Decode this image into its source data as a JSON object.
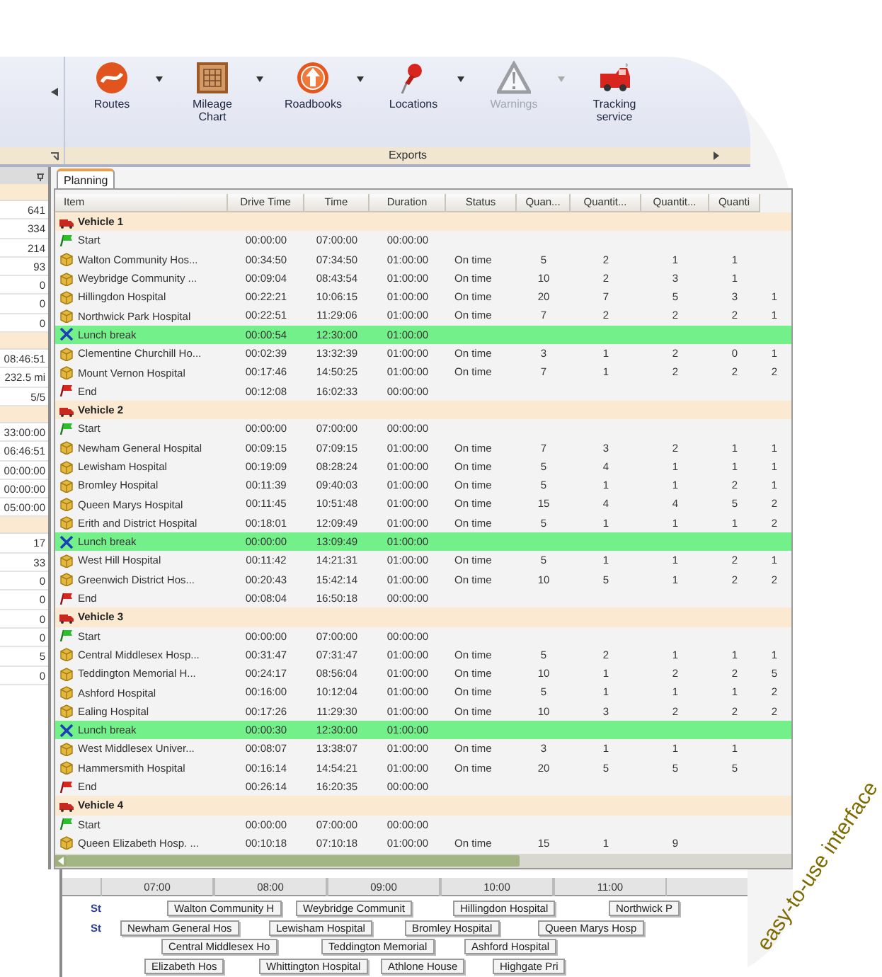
{
  "ribbon": {
    "buttons": [
      {
        "label": "Routes",
        "disabled": false,
        "dropdown": true
      },
      {
        "label": "Mileage Chart",
        "disabled": false,
        "dropdown": true
      },
      {
        "label": "Roadbooks",
        "disabled": false,
        "dropdown": true
      },
      {
        "label": "Locations",
        "disabled": false,
        "dropdown": true
      },
      {
        "label": "Warnings",
        "disabled": true,
        "dropdown": true
      },
      {
        "label": "Tracking service",
        "disabled": false,
        "dropdown": false
      }
    ],
    "group_label": "Exports"
  },
  "left_panel": {
    "sections": [
      {
        "values": [
          "641",
          "334",
          "214",
          "93",
          "0",
          "0",
          "0"
        ]
      },
      {
        "values": [
          "08:46:51",
          "232.5 mi",
          "5/5"
        ]
      },
      {
        "values": [
          "33:00:00",
          "06:46:51",
          "00:00:00",
          "00:00:00",
          "05:00:00"
        ]
      },
      {
        "values": [
          "17",
          "33",
          "0",
          "0",
          "0",
          "0",
          "5",
          "0"
        ]
      }
    ]
  },
  "tabs": [
    {
      "label": "Planning",
      "selected": true
    }
  ],
  "table": {
    "columns": [
      "Item",
      "Drive Time",
      "Time",
      "Duration",
      "Status",
      "Quan...",
      "Quantit...",
      "Quantit...",
      "Quanti"
    ],
    "rows": [
      {
        "kind": "vehicle",
        "cells": [
          "Vehicle 1"
        ]
      },
      {
        "kind": "start",
        "cells": [
          "Start",
          "00:00:00",
          "07:00:00",
          "00:00:00"
        ]
      },
      {
        "kind": "stop",
        "cells": [
          "Walton Community Hos...",
          "00:34:50",
          "07:34:50",
          "01:00:00",
          "On time",
          "5",
          "2",
          "1",
          "1"
        ]
      },
      {
        "kind": "stop",
        "cells": [
          "Weybridge Community ...",
          "00:09:04",
          "08:43:54",
          "01:00:00",
          "On time",
          "10",
          "2",
          "3",
          "1"
        ]
      },
      {
        "kind": "stop",
        "cells": [
          "Hillingdon Hospital",
          "00:22:21",
          "10:06:15",
          "01:00:00",
          "On time",
          "20",
          "7",
          "5",
          "3",
          "1"
        ]
      },
      {
        "kind": "stop",
        "cells": [
          "Northwick Park Hospital",
          "00:22:51",
          "11:29:06",
          "01:00:00",
          "On time",
          "7",
          "2",
          "2",
          "2",
          "1"
        ]
      },
      {
        "kind": "break",
        "cells": [
          "Lunch break",
          "00:00:54",
          "12:30:00",
          "01:00:00"
        ]
      },
      {
        "kind": "stop",
        "cells": [
          "Clementine Churchill Ho...",
          "00:02:39",
          "13:32:39",
          "01:00:00",
          "On time",
          "3",
          "1",
          "2",
          "0",
          "1"
        ]
      },
      {
        "kind": "stop",
        "cells": [
          "Mount Vernon Hospital",
          "00:17:46",
          "14:50:25",
          "01:00:00",
          "On time",
          "7",
          "1",
          "2",
          "2",
          "2"
        ]
      },
      {
        "kind": "end",
        "cells": [
          "End",
          "00:12:08",
          "16:02:33",
          "00:00:00"
        ]
      },
      {
        "kind": "vehicle",
        "cells": [
          "Vehicle 2"
        ]
      },
      {
        "kind": "start",
        "cells": [
          "Start",
          "00:00:00",
          "07:00:00",
          "00:00:00"
        ]
      },
      {
        "kind": "stop",
        "cells": [
          "Newham General Hospital",
          "00:09:15",
          "07:09:15",
          "01:00:00",
          "On time",
          "7",
          "3",
          "2",
          "1",
          "1"
        ]
      },
      {
        "kind": "stop",
        "cells": [
          "Lewisham Hospital",
          "00:19:09",
          "08:28:24",
          "01:00:00",
          "On time",
          "5",
          "4",
          "1",
          "1",
          "1"
        ]
      },
      {
        "kind": "stop",
        "cells": [
          "Bromley Hospital",
          "00:11:39",
          "09:40:03",
          "01:00:00",
          "On time",
          "5",
          "1",
          "1",
          "2",
          "1"
        ]
      },
      {
        "kind": "stop",
        "cells": [
          "Queen Marys Hospital",
          "00:11:45",
          "10:51:48",
          "01:00:00",
          "On time",
          "15",
          "4",
          "4",
          "5",
          "2"
        ]
      },
      {
        "kind": "stop",
        "cells": [
          "Erith and District Hospital",
          "00:18:01",
          "12:09:49",
          "01:00:00",
          "On time",
          "5",
          "1",
          "1",
          "1",
          "2"
        ]
      },
      {
        "kind": "break",
        "cells": [
          "Lunch break",
          "00:00:00",
          "13:09:49",
          "01:00:00"
        ]
      },
      {
        "kind": "stop",
        "cells": [
          "West Hill Hospital",
          "00:11:42",
          "14:21:31",
          "01:00:00",
          "On time",
          "5",
          "1",
          "1",
          "2",
          "1"
        ]
      },
      {
        "kind": "stop",
        "cells": [
          "Greenwich District Hos...",
          "00:20:43",
          "15:42:14",
          "01:00:00",
          "On time",
          "10",
          "5",
          "1",
          "2",
          "2"
        ]
      },
      {
        "kind": "end",
        "cells": [
          "End",
          "00:08:04",
          "16:50:18",
          "00:00:00"
        ]
      },
      {
        "kind": "vehicle",
        "cells": [
          "Vehicle 3"
        ]
      },
      {
        "kind": "start",
        "cells": [
          "Start",
          "00:00:00",
          "07:00:00",
          "00:00:00"
        ]
      },
      {
        "kind": "stop",
        "cells": [
          "Central Middlesex Hosp...",
          "00:31:47",
          "07:31:47",
          "01:00:00",
          "On time",
          "5",
          "2",
          "1",
          "1",
          "1"
        ]
      },
      {
        "kind": "stop",
        "cells": [
          "Teddington Memorial H...",
          "00:24:17",
          "08:56:04",
          "01:00:00",
          "On time",
          "10",
          "1",
          "2",
          "2",
          "5"
        ]
      },
      {
        "kind": "stop",
        "cells": [
          "Ashford Hospital",
          "00:16:00",
          "10:12:04",
          "01:00:00",
          "On time",
          "5",
          "1",
          "1",
          "1",
          "2"
        ]
      },
      {
        "kind": "stop",
        "cells": [
          "Ealing Hospital",
          "00:17:26",
          "11:29:30",
          "01:00:00",
          "On time",
          "10",
          "3",
          "2",
          "2",
          "2"
        ]
      },
      {
        "kind": "break",
        "cells": [
          "Lunch break",
          "00:00:30",
          "12:30:00",
          "01:00:00"
        ]
      },
      {
        "kind": "stop",
        "cells": [
          "West Middlesex Univer...",
          "00:08:07",
          "13:38:07",
          "01:00:00",
          "On time",
          "3",
          "1",
          "1",
          "1"
        ]
      },
      {
        "kind": "stop",
        "cells": [
          "Hammersmith Hospital",
          "00:16:14",
          "14:54:21",
          "01:00:00",
          "On time",
          "20",
          "5",
          "5",
          "5"
        ]
      },
      {
        "kind": "end",
        "cells": [
          "End",
          "00:26:14",
          "16:20:35",
          "00:00:00"
        ]
      },
      {
        "kind": "vehicle",
        "cells": [
          "Vehicle 4"
        ]
      },
      {
        "kind": "start",
        "cells": [
          "Start",
          "00:00:00",
          "07:00:00",
          "00:00:00"
        ]
      },
      {
        "kind": "stop",
        "cells": [
          "Queen Elizabeth Hosp. ...",
          "00:10:18",
          "07:10:18",
          "01:00:00",
          "On time",
          "15",
          "1",
          "9"
        ]
      }
    ]
  },
  "timeline": {
    "ticks": [
      "07:00",
      "08:00",
      "09:00",
      "10:00",
      "11:00"
    ],
    "rows": [
      {
        "marker": "St",
        "bars": [
          "Walton Community H",
          "Weybridge Communit",
          "Hillingdon Hospital",
          "Northwick P"
        ]
      },
      {
        "marker": "St",
        "bars": [
          "Newham General Hos",
          "Lewisham Hospital",
          "Bromley Hospital",
          "Queen Marys Hosp"
        ]
      },
      {
        "bars": [
          "Central Middlesex Ho",
          "Teddington Memorial",
          "Ashford Hospital"
        ]
      },
      {
        "bars": [
          "Elizabeth Hos",
          "Whittington Hospital",
          "Athlone House",
          "Highgate Pri"
        ]
      }
    ]
  },
  "caption": "easy-to-use interface"
}
